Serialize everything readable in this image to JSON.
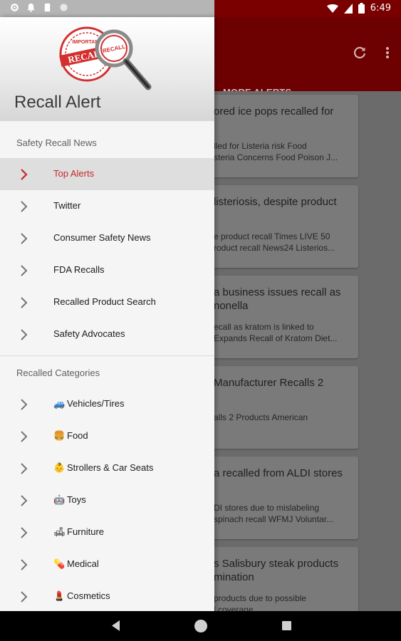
{
  "status_bar": {
    "time": "6:49",
    "left_icons": [
      "gear-icon",
      "bell-icon",
      "sd-card-icon",
      "circle-icon"
    ],
    "right_icons": [
      "wifi-icon",
      "signal-icon",
      "battery-icon"
    ]
  },
  "app": {
    "tab_label": "MORE ALERTS",
    "actions": [
      "refresh-icon",
      "more-vert-icon"
    ],
    "cards": [
      {
        "title": "ored ice pops recalled for",
        "snippet_1": "lled for Listeria risk  Food",
        "snippet_2": "steria Concerns  Food Poison J..."
      },
      {
        "title": "listeriosis, despite product",
        "snippet_1": "e product recall  Times LIVE  50",
        "snippet_2": "roduct recall  News24  Listerios..."
      },
      {
        "title": "a business issues recall as",
        "title_2": "nonella",
        "snippet_1": "ecall as kratom is linked to",
        "snippet_2": "Expands Recall of Kratom Diet..."
      },
      {
        "title": "Manufacturer Recalls 2",
        "snippet_1": "alls 2 Products  American",
        "snippet_2": ""
      },
      {
        "title": "a recalled from ALDI stores",
        "snippet_1": "DI stores due to mislabeling",
        "snippet_2": "spinach recall  WFMJ  Voluntar..."
      },
      {
        "title": "s Salisbury steak products",
        "title_2": "mination",
        "snippet_1": "products due to possible",
        "snippet_2": "l coverage"
      }
    ]
  },
  "drawer": {
    "title": "Recall Alert",
    "logo_text": [
      "IMPORTANT",
      "RECALL",
      "RECALL"
    ],
    "sections": [
      {
        "label": "Safety Recall News",
        "items": [
          {
            "label": "Top Alerts",
            "active": true
          },
          {
            "label": "Twitter"
          },
          {
            "label": "Consumer Safety News"
          },
          {
            "label": "FDA Recalls"
          },
          {
            "label": "Recalled Product Search"
          },
          {
            "label": "Safety Advocates"
          }
        ]
      },
      {
        "label": "Recalled Categories",
        "items": [
          {
            "label": "Vehicles/Tires",
            "emoji": "🚙"
          },
          {
            "label": "Food",
            "emoji": "🍔"
          },
          {
            "label": "Strollers & Car Seats",
            "emoji": "👶"
          },
          {
            "label": "Toys",
            "emoji": "🤖"
          },
          {
            "label": "Furniture",
            "emoji": "🛋"
          },
          {
            "label": "Medical",
            "emoji": "💊"
          },
          {
            "label": "Cosmetics",
            "emoji": "💄"
          }
        ]
      }
    ]
  },
  "colors": {
    "accent_red": "#c62828",
    "toolbar_dark_red": "#6d0000",
    "drawer_bg": "#f5f5f5"
  },
  "nav_bar": {
    "icons": [
      "back-icon",
      "home-icon",
      "recents-icon"
    ]
  }
}
